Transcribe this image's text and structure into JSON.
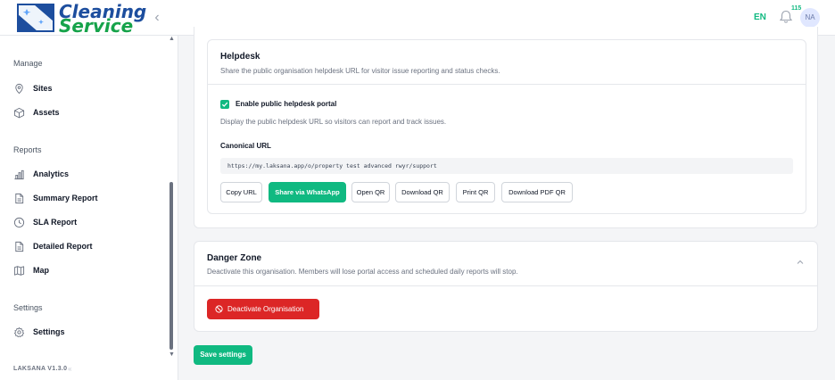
{
  "header": {
    "logo_line1": "Cleaning",
    "logo_line2": "Service",
    "language": "EN",
    "notification_count": "115",
    "avatar_initials": "NA"
  },
  "sidebar": {
    "sections": [
      {
        "label": "Manage",
        "items": [
          {
            "label": "Sites",
            "icon": "map-pin-icon"
          },
          {
            "label": "Assets",
            "icon": "cube-icon"
          }
        ]
      },
      {
        "label": "Reports",
        "items": [
          {
            "label": "Analytics",
            "icon": "bar-chart-icon"
          },
          {
            "label": "Summary Report",
            "icon": "document-icon"
          },
          {
            "label": "SLA Report",
            "icon": "clock-icon"
          },
          {
            "label": "Detailed Report",
            "icon": "document-icon"
          },
          {
            "label": "Map",
            "icon": "map-icon"
          }
        ]
      },
      {
        "label": "Settings",
        "items": [
          {
            "label": "Settings",
            "icon": "gear-icon"
          }
        ]
      }
    ],
    "version": "LAKSANA V1.3.0"
  },
  "helpdesk": {
    "title": "Helpdesk",
    "description": "Share the public organisation helpdesk URL for visitor issue reporting and status checks.",
    "enable_label": "Enable public helpdesk portal",
    "enabled": true,
    "enable_description": "Display the public helpdesk URL so visitors can report and track issues.",
    "url_label": "Canonical URL",
    "url": "https://my.laksana.app/o/property test advanced rwyr/support",
    "buttons": [
      "Copy URL",
      "Share via WhatsApp",
      "Open QR",
      "Download QR",
      "Print QR",
      "Download PDF QR"
    ]
  },
  "danger_zone": {
    "title": "Danger Zone",
    "description": "Deactivate this organisation. Members will lose portal access and scheduled daily reports will stop.",
    "deactivate_label": "Deactivate Organisation"
  },
  "save_label": "Save settings",
  "colors": {
    "accent": "#10b981",
    "danger": "#dc2626",
    "brand_blue": "#1d4e9e",
    "brand_green": "#16a34a"
  }
}
